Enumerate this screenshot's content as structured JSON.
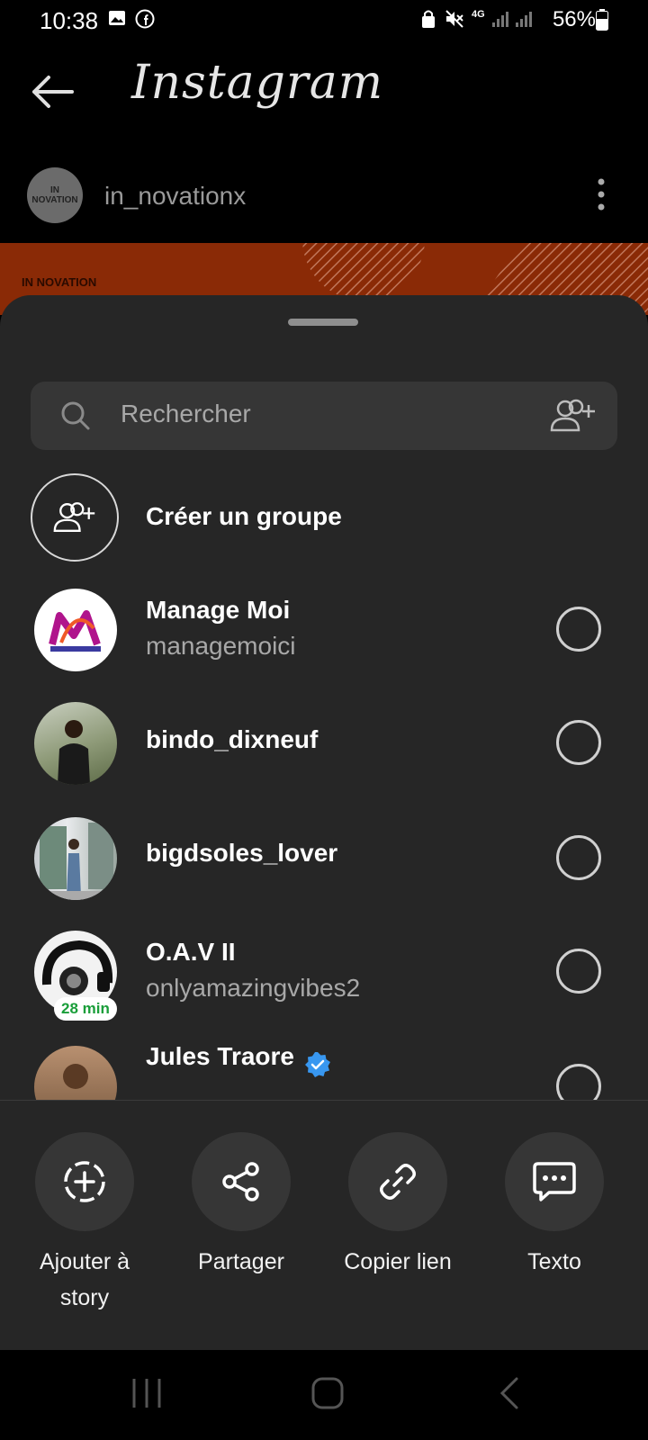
{
  "status_bar": {
    "time": "10:38",
    "battery": "56%",
    "network": "4G"
  },
  "header": {
    "app_title": "Instagram"
  },
  "post": {
    "username": "in_novationx",
    "avatar_text": "IN NOVATION",
    "brand_text": "IN NOVATION"
  },
  "sheet": {
    "search_placeholder": "Rechercher",
    "create_group_label": "Créer un groupe",
    "contacts": [
      {
        "name": "Manage Moi",
        "handle": "managemoici"
      },
      {
        "name": "bindo_dixneuf",
        "handle": ""
      },
      {
        "name": "bigdsoles_lover",
        "handle": ""
      },
      {
        "name": "O.A.V II",
        "handle": "onlyamazingvibes2",
        "badge": "28 min"
      },
      {
        "name": "Jules Traore",
        "handle": "",
        "verified": true
      }
    ],
    "actions": [
      {
        "label": "Ajouter à story"
      },
      {
        "label": "Partager"
      },
      {
        "label": "Copier lien"
      },
      {
        "label": "Texto"
      }
    ]
  },
  "colors": {
    "sheet_bg": "#262626",
    "verified_blue": "#3897f0",
    "badge_green": "#1a9e3a",
    "post_orange": "#8a2a06"
  }
}
